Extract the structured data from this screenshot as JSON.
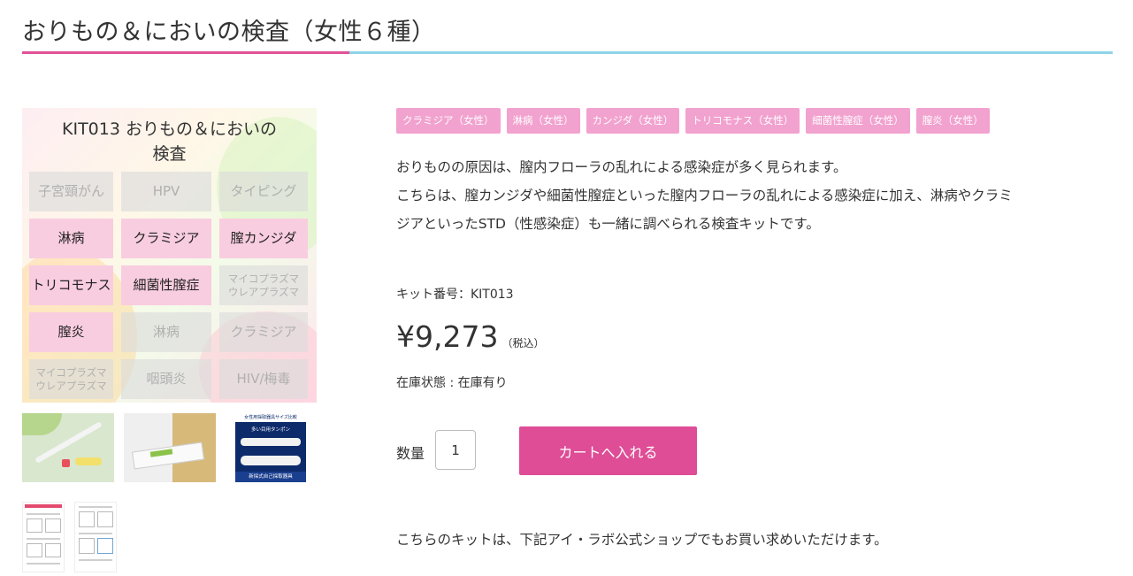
{
  "title": "おりもの＆においの検査（女性６種）",
  "colors": {
    "accent_pink": "#de4d96",
    "rule_blue": "#8fd3e8",
    "tag_pink": "#f2a2cf",
    "cell_on": "#f9cde0"
  },
  "gallery": {
    "kit_title": "KIT013 おりもの＆においの\n検査",
    "cells": [
      {
        "label": "子宮頸がん",
        "on": false
      },
      {
        "label": "HPV",
        "on": false
      },
      {
        "label": "タイピング",
        "on": false
      },
      {
        "label": "淋病",
        "on": true
      },
      {
        "label": "クラミジア",
        "on": true
      },
      {
        "label": "膣カンジダ",
        "on": true
      },
      {
        "label": "トリコモナス",
        "on": true
      },
      {
        "label": "細菌性膣症",
        "on": true
      },
      {
        "label": "マイコプラズマ\nウレアプラズマ",
        "on": false
      },
      {
        "label": "膣炎",
        "on": true
      },
      {
        "label": "淋病",
        "on": false
      },
      {
        "label": "クラミジア",
        "on": false
      },
      {
        "label": "マイコプラズマ\nウレアプラズマ",
        "on": false
      },
      {
        "label": "咽頭炎",
        "on": false
      },
      {
        "label": "HIV/梅毒",
        "on": false
      }
    ],
    "thumb3": {
      "top_text": "女性用採取器具サイズ比較",
      "mid_text": "多い目用タンポン",
      "bottom_text": "新採式自己採取器具"
    }
  },
  "tags": [
    "クラミジア（女性）",
    "淋病（女性）",
    "カンジダ（女性）",
    "トリコモナス（女性）",
    "細菌性膣症（女性）",
    "膣炎（女性）"
  ],
  "description": [
    "おりものの原因は、膣内フローラの乱れによる感染症が多く見られます。",
    "こちらは、膣カンジダや細菌性膣症といった膣内フローラの乱れによる感染症に加え、淋病やクラミ",
    "ジアといったSTD（性感染症）も一緒に調べられる検査キットです。"
  ],
  "kit_number": "キット番号：KIT013",
  "price": "¥9,273",
  "tax_note": "（税込）",
  "stock": "在庫状態 : 在庫有り",
  "quantity": {
    "label": "数量",
    "value": "1"
  },
  "cart_button": "カートへ入れる",
  "footer_note": "こちらのキットは、下記アイ・ラボ公式ショップでもお買い求めいただけます。"
}
